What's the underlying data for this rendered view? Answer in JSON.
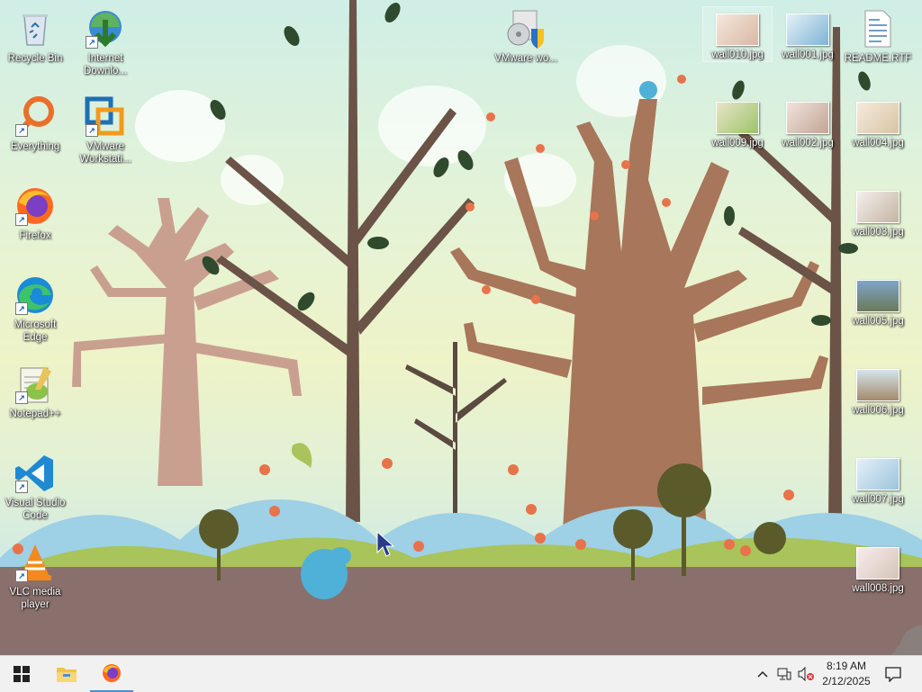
{
  "desktop": {
    "icons_left": [
      {
        "label": "Recycle Bin",
        "icon": "recycle-bin-icon"
      },
      {
        "label": "Internet Downlo...",
        "icon": "download-manager-icon"
      },
      {
        "label": "Everything",
        "icon": "everything-search-icon"
      },
      {
        "label": "VMware Workstati...",
        "icon": "vmware-workstation-icon"
      },
      {
        "label": "Firefox",
        "icon": "firefox-icon"
      },
      {
        "label": "Microsoft Edge",
        "icon": "edge-icon"
      },
      {
        "label": "Notepad++",
        "icon": "notepadpp-icon"
      },
      {
        "label": "Visual Studio Code",
        "icon": "vscode-icon"
      },
      {
        "label": "VLC media player",
        "icon": "vlc-icon"
      }
    ],
    "vmware_top": {
      "label": "VMware wo...",
      "icon": "vmware-setup-icon"
    },
    "files": [
      {
        "label": "wall010.jpg"
      },
      {
        "label": "wall001.jpg"
      },
      {
        "label": "README.RTF"
      },
      {
        "label": "wall009.jpg"
      },
      {
        "label": "wall002.jpg"
      },
      {
        "label": "wall004.jpg"
      },
      {
        "label": "wall003.jpg"
      },
      {
        "label": "wall005.jpg"
      },
      {
        "label": "wall006.jpg"
      },
      {
        "label": "wall007.jpg"
      },
      {
        "label": "wall008.jpg"
      }
    ]
  },
  "taskbar": {
    "start": "start-windows-icon",
    "apps": [
      "file-explorer-icon",
      "firefox-icon"
    ],
    "clock": {
      "time": "8:19 AM",
      "date": "2/12/2025"
    },
    "tray": [
      "chevron-up-icon",
      "network-icon",
      "volume-muted-icon",
      "notification-icon"
    ]
  }
}
